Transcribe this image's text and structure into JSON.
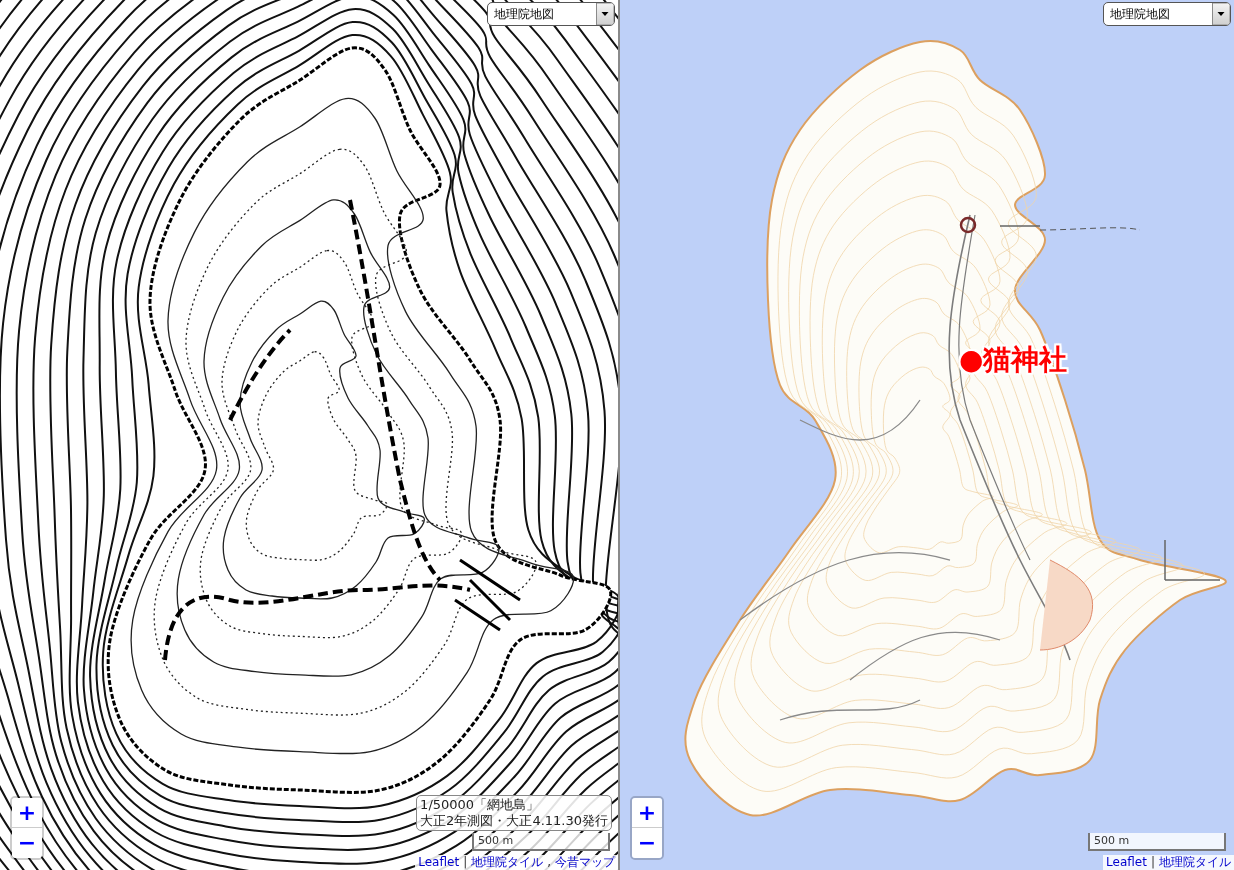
{
  "panes": [
    {
      "kind": "old",
      "layer_select": {
        "value": "地理院地図"
      },
      "zoom": {
        "in": "+",
        "out": "−"
      },
      "info": {
        "lines": [
          "1/50000「網地島」",
          "大正2年測図・大正4.11.30発行"
        ]
      },
      "scale": "500 m",
      "attribution": [
        {
          "kind": "link",
          "text": "Leaflet"
        },
        {
          "kind": "separator",
          "text": "|"
        },
        {
          "kind": "link",
          "text": "地理院タイル"
        },
        {
          "kind": "separator",
          "text": ","
        },
        {
          "kind": "link",
          "text": "今昔マップ"
        }
      ]
    },
    {
      "kind": "modern",
      "layer_select": {
        "value": "地理院地図"
      },
      "marker": {
        "label": "●猫神社"
      },
      "zoom": {
        "in": "+",
        "out": "−"
      },
      "scale": "500 m",
      "attribution": [
        {
          "kind": "link",
          "text": "Leaflet"
        },
        {
          "kind": "separator",
          "text": "|"
        },
        {
          "kind": "link",
          "text": "地理院タイル"
        }
      ]
    }
  ]
}
